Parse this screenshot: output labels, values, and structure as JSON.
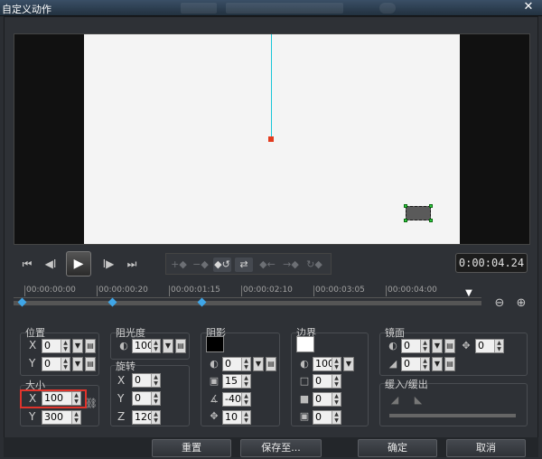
{
  "window": {
    "title": "自定义动作",
    "close_glyph": "✕"
  },
  "transport": {
    "buttons": [
      "⏮",
      "◀Ⅰ",
      "▶",
      "Ⅰ▶",
      "⏭"
    ],
    "keyframe_buttons": [
      "+◆",
      "−◆",
      "◆↺",
      "⇄",
      "◆←",
      "→◆",
      "↻◆"
    ],
    "timecode": "0:00:04.24"
  },
  "timeline": {
    "ticks": [
      "00:00:00:00",
      "00:00:00:20",
      "00:00:01:15",
      "00:00:02:10",
      "00:00:03:05",
      "00:00:04:00"
    ]
  },
  "position": {
    "label": "位置",
    "x": "0",
    "y": "0"
  },
  "opacity": {
    "label": "阻光度",
    "value": "100"
  },
  "rotation": {
    "label": "旋转",
    "x": "0",
    "y": "0",
    "z": "120"
  },
  "size": {
    "label": "大小",
    "x": "100",
    "y": "300"
  },
  "shadow": {
    "label": "阴影",
    "color": "#000000",
    "opacity": "0",
    "blur": "15",
    "angle": "-40",
    "distance": "10"
  },
  "border": {
    "label": "边界",
    "color": "#ffffff",
    "opacity": "100",
    "width": "0",
    "v2": "0",
    "v3": "0"
  },
  "mirror": {
    "label": "镜面",
    "opacity": "0",
    "distance": "0",
    "offset": "0"
  },
  "easing": {
    "label": "缓入/缓出"
  },
  "axes": {
    "x": "X",
    "y": "Y",
    "z": "Z"
  },
  "footer": {
    "reset": "重置",
    "save_to": "保存至...",
    "ok": "确定",
    "cancel": "取消"
  }
}
